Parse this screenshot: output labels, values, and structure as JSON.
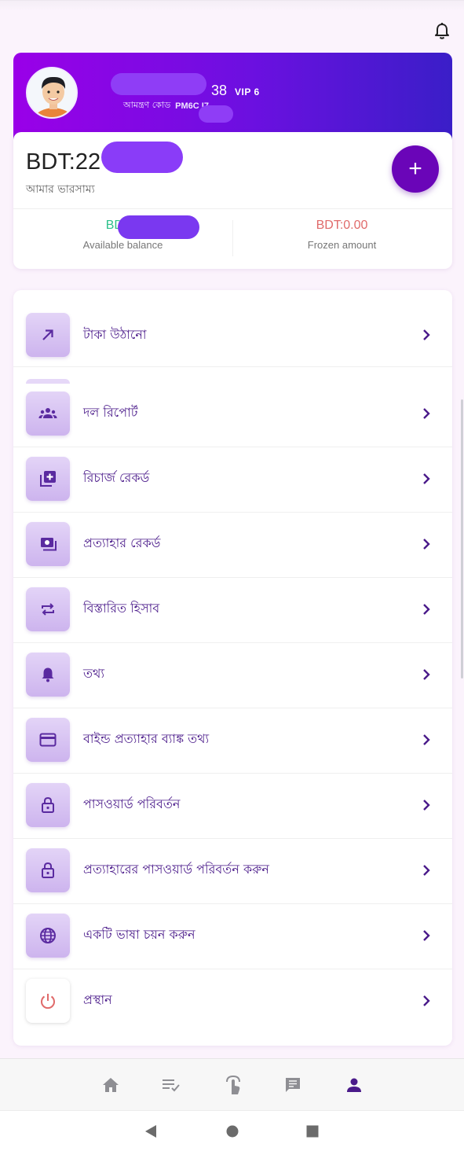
{
  "profile": {
    "name_visible": "38",
    "vip_label": "VIP 6",
    "invite_label": "আমন্ত্রণ কোড",
    "invite_code_visible": "PM6C I7"
  },
  "balance": {
    "amount_visible": "BDT:22",
    "label": "আমার ভারসাম্য",
    "add_symbol": "+",
    "available_value_visible": "BDT:2",
    "available_label": "Available balance",
    "frozen_value": "BDT:0.00",
    "frozen_label": "Frozen amount"
  },
  "colors": {
    "accent": "#6a05b8",
    "available": "#2cc08b",
    "frozen": "#e06a6a",
    "menu_text": "#4a1a8a"
  },
  "menu": {
    "items": [
      {
        "label": "টাকা উঠানো",
        "icon": "arrow-up-right-icon"
      },
      {
        "label": "দল রিপোর্ট",
        "icon": "group-icon"
      },
      {
        "label": "রিচার্জ রেকর্ড",
        "icon": "add-box-icon"
      },
      {
        "label": "প্রত্যাহার রেকর্ড",
        "icon": "money-icon"
      },
      {
        "label": "বিস্তারিত হিসাব",
        "icon": "repeat-icon"
      },
      {
        "label": "তথ্য",
        "icon": "bell-icon"
      },
      {
        "label": "বাইন্ড প্রত্যাহার ব্যাঙ্ক তথ্য",
        "icon": "credit-card-icon"
      },
      {
        "label": "পাসওয়ার্ড পরিবর্তন",
        "icon": "lock-icon"
      },
      {
        "label": "প্রত্যাহারের পাসওয়ার্ড পরিবর্তন করুন",
        "icon": "lock-icon"
      },
      {
        "label": "একটি ভাষা চয়ন করুন",
        "icon": "globe-icon"
      },
      {
        "label": "প্রস্থান",
        "icon": "power-icon"
      }
    ]
  },
  "bottom_nav": [
    "home-icon",
    "tasks-icon",
    "tap-icon",
    "message-icon",
    "profile-icon"
  ]
}
